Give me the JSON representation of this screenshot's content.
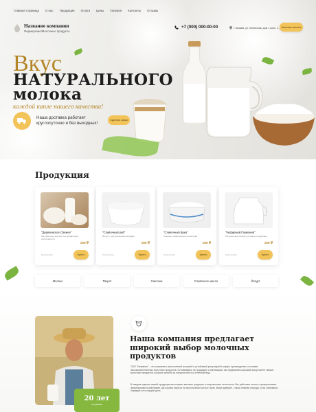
{
  "nav": [
    "Главная страница",
    "О нас",
    "Продукция",
    "Услуги",
    "Цены",
    "Галерея",
    "Контакты",
    "Отзывы"
  ],
  "header": {
    "company_name": "Название компании",
    "company_sub": "Фермерские/Молочные продукты",
    "phone": "+7 (000) 000-00-00",
    "address": "г. Москва, ул. Ленинская, дом 1 корп. 1, офис 1",
    "callback_label": "Заказать звонок"
  },
  "hero": {
    "title_1": "Вкус",
    "title_2": "НАТУРАЛЬНОГО",
    "title_3": "молока",
    "slogan": "каждой капле нашего качества!",
    "delivery_text": "Наша доставка работает круглосуточно и без выходных!",
    "order_label": "Сделать заказ"
  },
  "products": {
    "title": "Продукция",
    "items": [
      {
        "name": "\"Деревенское Свежее\"",
        "desc": "Натуральное молоко без добавления консервантов",
        "price": "150 ₽",
        "qty": "Количество",
        "btn": "Купить"
      },
      {
        "name": "\"Сливочный рай\"",
        "desc": "Йогурт с натуральными ягодами",
        "price": "150 ₽",
        "qty": "Количество",
        "btn": "Купить"
      },
      {
        "name": "\"Сливочный Бриз\"",
        "desc": "Нежные сливки высшего качества",
        "price": "150 ₽",
        "qty": "Количество",
        "btn": "Купить"
      },
      {
        "name": "\"Кефирный Гармония\"",
        "desc": "Натуральный кефир для вашего здоровья",
        "price": "150 ₽",
        "qty": "Количество",
        "btn": "Купить"
      }
    ],
    "categories": [
      "Молоко",
      "Творог",
      "Сметана",
      "Сливочное масло",
      "Йогурт"
    ]
  },
  "about": {
    "heading": "Наша компания предлагает широкий выбор молочных продуктов",
    "para1": "ООО \"Название\" – это компания с многолетней историей и устойчивой репутацией в сфере производства и поставки высококачественных молочных продуктов. Основываясь на традициях и инновациях, мы предлагаем широкий ассортимент свежих молочных продуктов, которые ценятся за натуральность и отличный вкус.",
    "para2": "В каждом изделии нашей продукции воплощены вековые традиции и современные технологии. Мы работаем только с проверенными фермерскими хозяйствами, где коровы пасутся на экологически чистых лугах. Ваше доверие – наша главная награда, и мы стремимся оправдать его каждый день.",
    "years": "20 лет",
    "years_sub": "на рынке"
  },
  "colors": {
    "accent": "#f2c358",
    "gold_text": "#b48526",
    "green": "#86b840"
  }
}
